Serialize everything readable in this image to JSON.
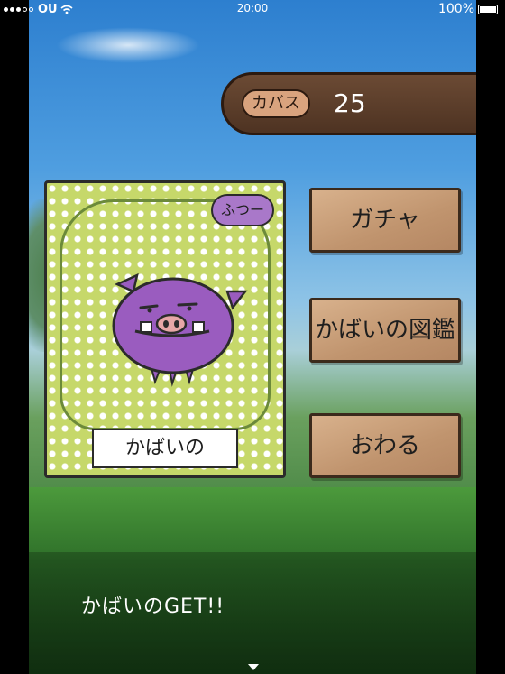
{
  "status_bar": {
    "carrier": "OU",
    "time": "20:00",
    "battery": "100%",
    "signal_icon": "signal-dots-icon",
    "wifi_icon": "wifi-icon",
    "battery_icon": "battery-icon"
  },
  "currency": {
    "label": "カバス",
    "value": "25"
  },
  "card": {
    "rarity": "ふつー",
    "name": "かばいの",
    "creature_color": "#9a5cbf"
  },
  "menu": {
    "gacha": "ガチャ",
    "encyclopedia": "かばいの図鑑",
    "end": "おわる"
  },
  "message": {
    "text": "かばいのGET!!"
  }
}
